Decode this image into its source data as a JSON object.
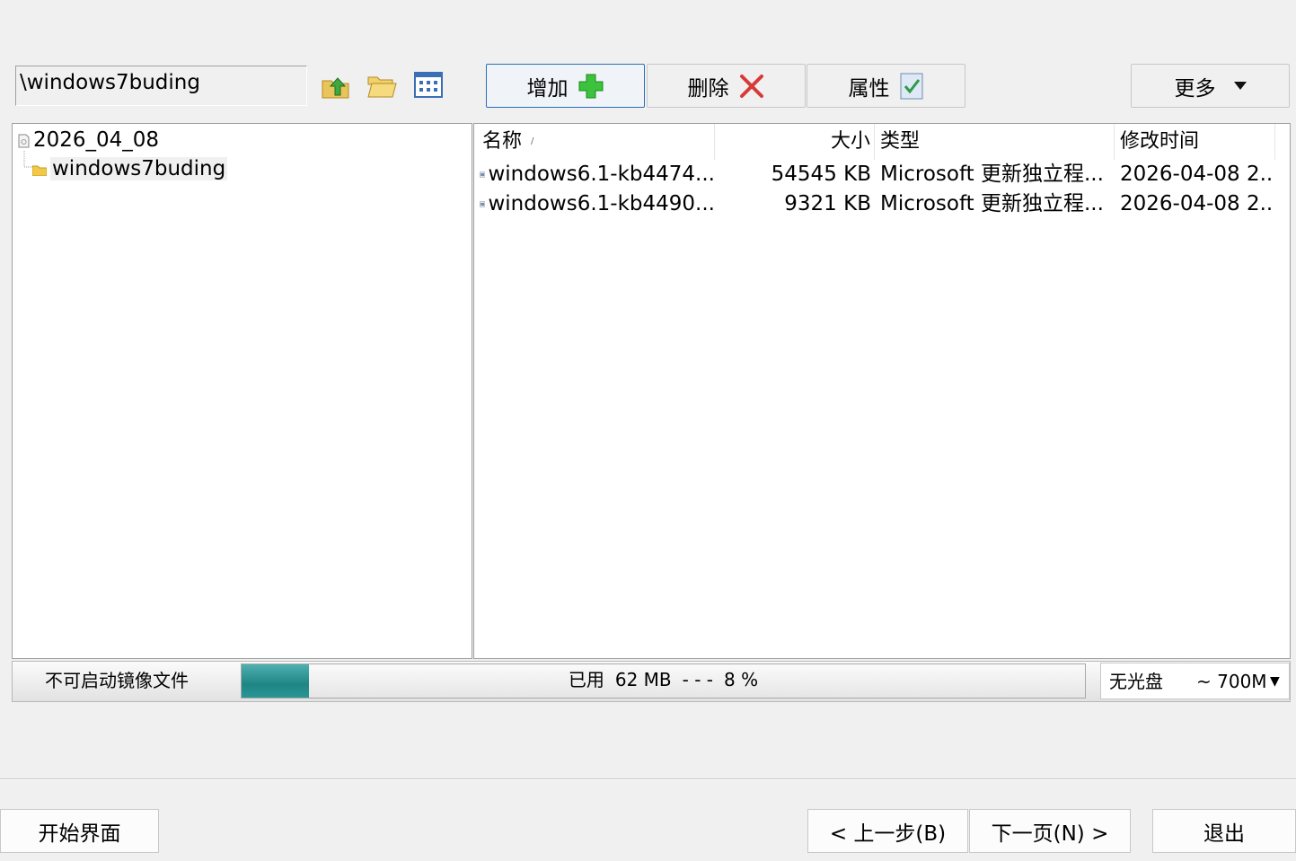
{
  "toolbar": {
    "path": "\\windows7buding",
    "add_label": "增加",
    "delete_label": "删除",
    "props_label": "属性",
    "more_label": "更多",
    "icons": [
      "folder-up-icon",
      "folder-open-icon",
      "view-grid-icon",
      "add-plus-icon",
      "delete-x-icon",
      "properties-icon",
      "dropdown-caret-icon"
    ]
  },
  "tree": {
    "root": "2026_04_08",
    "child": "windows7buding"
  },
  "file_list": {
    "columns": [
      "名称",
      "大小",
      "类型",
      "修改时间"
    ],
    "rows": [
      {
        "name": "windows6.1-kb4474...",
        "size": "54545 KB",
        "type": "Microsoft 更新独立程...",
        "time": "2026-04-08 2..."
      },
      {
        "name": "windows6.1-kb4490...",
        "size": "9321 KB",
        "type": "Microsoft 更新独立程...",
        "time": "2026-04-08 2..."
      }
    ]
  },
  "status": {
    "label": "不可启动镜像文件",
    "used_prefix": "已用",
    "used_value": "62 MB",
    "dashes": "- - -",
    "percent_text": "8 %",
    "progress_fraction": 0.08,
    "disc_type": "无光盘",
    "disc_size": "~ 700M"
  },
  "nav": {
    "start": "开始界面",
    "prev": "< 上一步(B)",
    "next": "下一页(N) >",
    "exit": "退出"
  },
  "colors": {
    "accent_border": "#2b6fb6",
    "progress_fill": "#1f8585"
  }
}
